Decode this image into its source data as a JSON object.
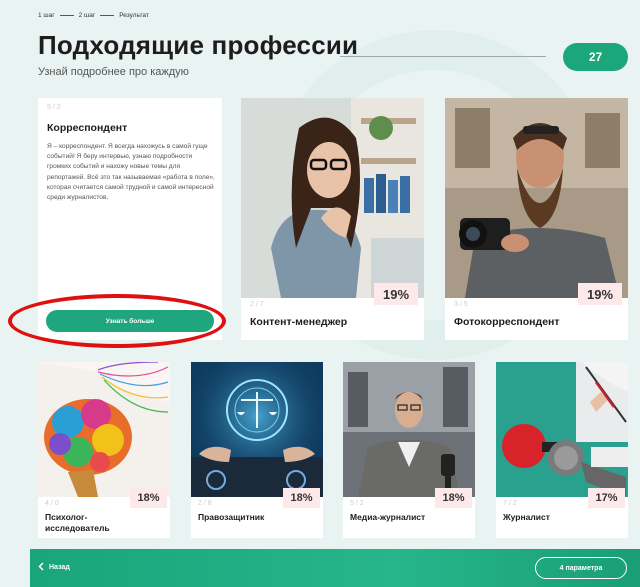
{
  "steps": [
    "1 шаг",
    "2 шаг",
    "Результат"
  ],
  "header": {
    "title": "Подходящие профессии",
    "subtitle": "Узнай подробнее про каждую",
    "count": "27"
  },
  "info_card": {
    "faint": "5 / 2",
    "name": "Корреспондент",
    "description": "Я – корреспондент. Я всегда нахожусь в самой гуще событий! Я беру интервью, узнаю подробности громких событий и нахожу новые темы для репортажей. Всё это так называемая «работа в поле», которая считается самой трудной и самой интересной среди журналистов.",
    "button": "Узнать больше"
  },
  "cards": [
    {
      "name": "Контент-менеджер",
      "percent": "19%",
      "faint": "2 / 7"
    },
    {
      "name": "Фотокорреспондент",
      "percent": "19%",
      "faint": "3 / 5"
    },
    {
      "name": "Психолог-\nисследователь",
      "percent": "18%",
      "faint": "4 / 0"
    },
    {
      "name": "Правозащитник",
      "percent": "18%",
      "faint": "2 / 8"
    },
    {
      "name": "Медиа-журналист",
      "percent": "18%",
      "faint": "5 / 2"
    },
    {
      "name": "Журналист",
      "percent": "17%",
      "faint": "7 / 2"
    }
  ],
  "footer": {
    "back": "Назад",
    "params": "4 параметра"
  },
  "colors": {
    "accent": "#1ba779",
    "badge_bg": "#fde8ea",
    "highlight": "#e01010"
  }
}
